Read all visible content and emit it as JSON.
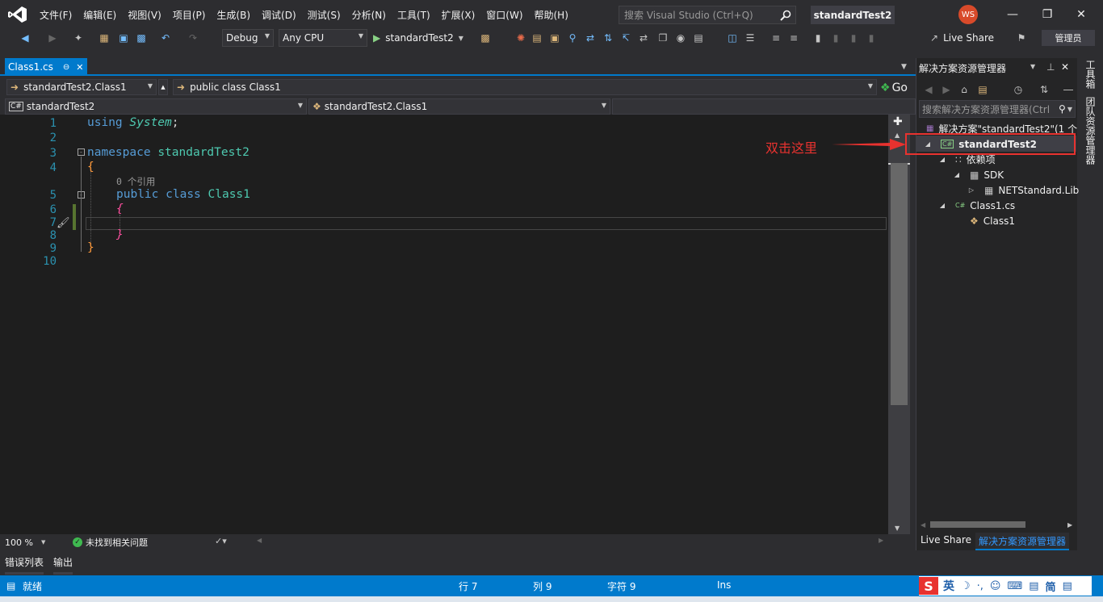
{
  "menu": {
    "items": [
      "文件(F)",
      "编辑(E)",
      "视图(V)",
      "项目(P)",
      "生成(B)",
      "调试(D)",
      "测试(S)",
      "分析(N)",
      "工具(T)",
      "扩展(X)",
      "窗口(W)",
      "帮助(H)"
    ],
    "search_placeholder": "搜索 Visual Studio (Ctrl+Q)",
    "solution_title": "standardTest2",
    "avatar_initials": "WS"
  },
  "toolbar": {
    "config": "Debug",
    "platform": "Any CPU",
    "run_target": "standardTest2",
    "live_share": "Live Share",
    "admin": "管理员"
  },
  "document_tab": {
    "label": "Class1.cs"
  },
  "nav": {
    "type_combo": "standardTest2.Class1",
    "member_combo": "public class Class1",
    "go_label": "Go",
    "project_combo": "standardTest2",
    "scope_combo": "standardTest2.Class1"
  },
  "editor": {
    "line_numbers": [
      "1",
      "2",
      "3",
      "4",
      "5",
      "6",
      "7",
      "8",
      "9",
      "10"
    ],
    "code": {
      "using_kw": "using",
      "using_ns": "System",
      "semicolon": ";",
      "namespace_kw": "namespace",
      "namespace_name": "standardTest2",
      "open_brace_1": "{",
      "references": "0 个引用",
      "public_kw": "public",
      "class_kw": "class",
      "class_name": "Class1",
      "open_brace_2": "{",
      "close_brace_2": "}",
      "close_brace_1": "}"
    }
  },
  "editor_status": {
    "zoom": "100 %",
    "issues": "未找到相关问题"
  },
  "bottom_tabs": [
    "错误列表",
    "输出"
  ],
  "statusbar": {
    "ready": "就绪",
    "row": "行 7",
    "col": "列 9",
    "char": "字符 9",
    "mode": "Ins",
    "ime": "英",
    "ime_letters": "简"
  },
  "solution_explorer": {
    "title": "解决方案资源管理器",
    "search_placeholder": "搜索解决方案资源管理器(Ctrl",
    "tree": {
      "solution": "解决方案\"standardTest2\"(1 个",
      "project": "standardTest2",
      "dependencies": "依赖项",
      "sdk": "SDK",
      "netstandard": "NETStandard.Lib",
      "class_file": "Class1.cs",
      "class_item": "Class1"
    },
    "bottom_tabs": [
      "Live Share",
      "解决方案资源管理器"
    ]
  },
  "right_rail": [
    "工具箱",
    "团队资源管理器"
  ],
  "annotation": {
    "text": "双击这里",
    "color": "#e8322f"
  },
  "colors": {
    "accent": "#007acc",
    "annotation": "#e8322f"
  }
}
